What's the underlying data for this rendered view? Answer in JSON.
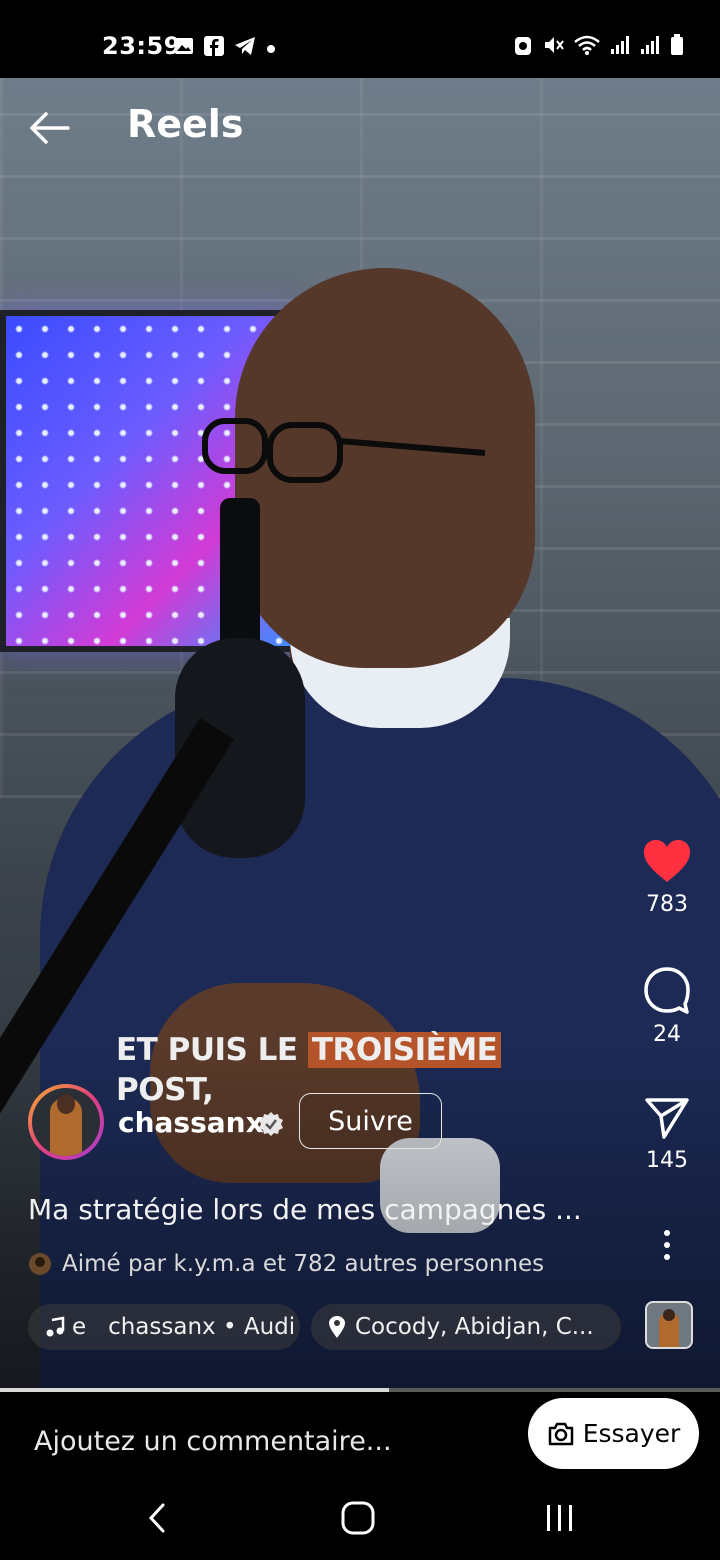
{
  "status_bar": {
    "time": "23:59",
    "left_icons": [
      "gallery-icon",
      "facebook-icon",
      "telegram-icon",
      "dot-icon"
    ],
    "right_icons": [
      "alarm-icon",
      "mute-icon",
      "wifi-icon",
      "signal-icon",
      "signal-icon",
      "battery-icon"
    ]
  },
  "header": {
    "title": "Reels",
    "back_icon": "back-arrow-icon"
  },
  "video": {
    "caption_line1_pre": "ET PUIS LE ",
    "caption_line1_highlight": "TROISIÈME",
    "caption_line2": "POST,",
    "progress": 0.54
  },
  "actions": {
    "likes": "783",
    "comments": "24",
    "shares": "145",
    "like_color": "#ff3040"
  },
  "author": {
    "username": "chassanx",
    "follow_label": "Suivre"
  },
  "description": "Ma stratégie lors de mes campagnes ...",
  "liked_by": "Aimé par k.y.m.a et 782 autres personnes",
  "audio_pill": "e   chassanx • Audi",
  "location_pill": "Cocody, Abidjan, C...",
  "comment_bar": {
    "placeholder": "Ajoutez un commentaire...",
    "try_label": "Essayer"
  },
  "nav": [
    "back-nav-icon",
    "home-nav-icon",
    "recents-nav-icon"
  ]
}
